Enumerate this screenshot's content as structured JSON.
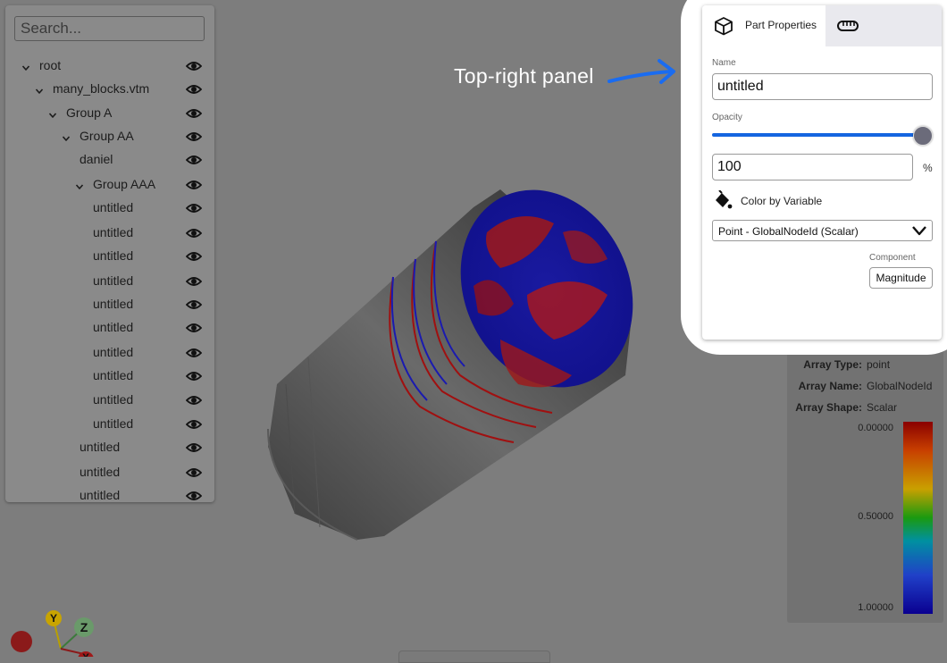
{
  "search": {
    "placeholder": "Search..."
  },
  "tree": [
    {
      "label": "root",
      "expanded": true,
      "depth": 0
    },
    {
      "label": "many_blocks.vtm",
      "expanded": true,
      "depth": 1
    },
    {
      "label": "Group A",
      "expanded": true,
      "depth": 2
    },
    {
      "label": "Group AA",
      "expanded": true,
      "depth": 3
    },
    {
      "label": "daniel",
      "depth": 4
    },
    {
      "label": "Group AAA",
      "expanded": true,
      "depth": 4
    },
    {
      "label": "untitled",
      "depth": 5
    },
    {
      "label": "untitled",
      "depth": 5
    },
    {
      "label": "untitled",
      "depth": 5
    },
    {
      "label": "untitled",
      "depth": 5
    },
    {
      "label": "untitled",
      "depth": 5
    },
    {
      "label": "untitled",
      "depth": 5
    },
    {
      "label": "untitled",
      "depth": 5
    },
    {
      "label": "untitled",
      "depth": 5
    },
    {
      "label": "untitled",
      "depth": 5
    },
    {
      "label": "untitled",
      "depth": 5
    },
    {
      "label": "untitled",
      "depth": 4
    },
    {
      "label": "untitled",
      "depth": 4
    },
    {
      "label": "untitled",
      "depth": 4
    }
  ],
  "annotation": {
    "text": "Top-right panel",
    "color": "#1a6cf0"
  },
  "props": {
    "tab_part_label": "Part Properties",
    "tab_part_icon": "cube-icon",
    "tab_measure_icon": "ruler-icon",
    "name_label": "Name",
    "name_value": "untitled",
    "opacity_label": "Opacity",
    "opacity_value": "100",
    "opacity_fraction": 1.0,
    "percent_sign": "%",
    "color_by_label": "Color by Variable",
    "color_by_icon": "paint-bucket-icon",
    "color_by_value": "Point - GlobalNodeId (Scalar)",
    "component_label": "Component",
    "component_value": "Magnitude",
    "accent_color": "#1565e0"
  },
  "scalar_bar": {
    "array_type_key": "Array Type:",
    "array_type_val": "point",
    "array_name_key": "Array Name:",
    "array_name_val": "GlobalNodeId",
    "array_shape_key": "Array Shape:",
    "array_shape_val": "Scalar",
    "ticks": [
      "0.00000",
      "0.50000",
      "1.00000"
    ]
  },
  "axes": {
    "y": "Y",
    "z": "Z",
    "x": "X"
  }
}
